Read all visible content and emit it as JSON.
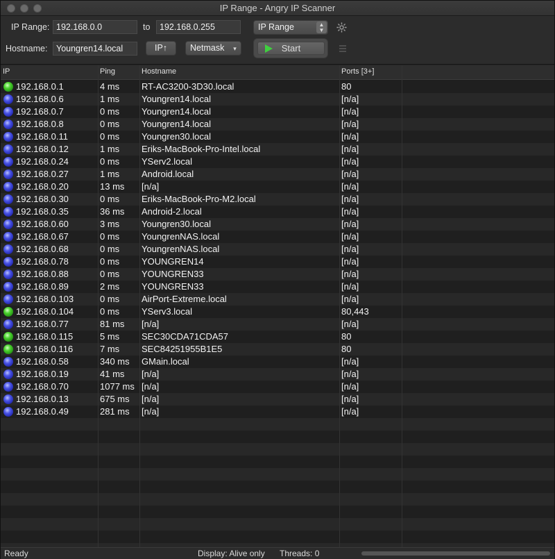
{
  "window": {
    "title": "IP Range - Angry IP Scanner"
  },
  "toolbar": {
    "ip_range_label": "IP Range:",
    "ip_start": "192.168.0.0",
    "to_label": "to",
    "ip_end": "192.168.0.255",
    "feeder_select": "IP Range",
    "hostname_label": "Hostname:",
    "hostname_value": "Youngren14.local",
    "ip_up_button": "IP↑",
    "netmask_select": "Netmask",
    "start_button": "Start"
  },
  "table": {
    "columns": [
      "IP",
      "Ping",
      "Hostname",
      "Ports [3+]"
    ],
    "rows": [
      {
        "status": "green",
        "ip": "192.168.0.1",
        "ping": "4 ms",
        "hostname": "RT-AC3200-3D30.local",
        "ports": "80"
      },
      {
        "status": "blue",
        "ip": "192.168.0.6",
        "ping": "1 ms",
        "hostname": "Youngren14.local",
        "ports": "[n/a]"
      },
      {
        "status": "blue",
        "ip": "192.168.0.7",
        "ping": "0 ms",
        "hostname": "Youngren14.local",
        "ports": "[n/a]"
      },
      {
        "status": "blue",
        "ip": "192.168.0.8",
        "ping": "0 ms",
        "hostname": "Youngren14.local",
        "ports": "[n/a]"
      },
      {
        "status": "blue",
        "ip": "192.168.0.11",
        "ping": "0 ms",
        "hostname": "Youngren30.local",
        "ports": "[n/a]"
      },
      {
        "status": "blue",
        "ip": "192.168.0.12",
        "ping": "1 ms",
        "hostname": "Eriks-MacBook-Pro-Intel.local",
        "ports": "[n/a]"
      },
      {
        "status": "blue",
        "ip": "192.168.0.24",
        "ping": "0 ms",
        "hostname": "YServ2.local",
        "ports": "[n/a]"
      },
      {
        "status": "blue",
        "ip": "192.168.0.27",
        "ping": "1 ms",
        "hostname": "Android.local",
        "ports": "[n/a]"
      },
      {
        "status": "blue",
        "ip": "192.168.0.20",
        "ping": "13 ms",
        "hostname": "[n/a]",
        "ports": "[n/a]"
      },
      {
        "status": "blue",
        "ip": "192.168.0.30",
        "ping": "0 ms",
        "hostname": "Eriks-MacBook-Pro-M2.local",
        "ports": "[n/a]"
      },
      {
        "status": "blue",
        "ip": "192.168.0.35",
        "ping": "36 ms",
        "hostname": "Android-2.local",
        "ports": "[n/a]"
      },
      {
        "status": "blue",
        "ip": "192.168.0.60",
        "ping": "3 ms",
        "hostname": "Youngren30.local",
        "ports": "[n/a]"
      },
      {
        "status": "blue",
        "ip": "192.168.0.67",
        "ping": "0 ms",
        "hostname": "YoungrenNAS.local",
        "ports": "[n/a]"
      },
      {
        "status": "blue",
        "ip": "192.168.0.68",
        "ping": "0 ms",
        "hostname": "YoungrenNAS.local",
        "ports": "[n/a]"
      },
      {
        "status": "blue",
        "ip": "192.168.0.78",
        "ping": "0 ms",
        "hostname": "YOUNGREN14",
        "ports": "[n/a]"
      },
      {
        "status": "blue",
        "ip": "192.168.0.88",
        "ping": "0 ms",
        "hostname": "YOUNGREN33",
        "ports": "[n/a]"
      },
      {
        "status": "blue",
        "ip": "192.168.0.89",
        "ping": "2 ms",
        "hostname": "YOUNGREN33",
        "ports": "[n/a]"
      },
      {
        "status": "blue",
        "ip": "192.168.0.103",
        "ping": "0 ms",
        "hostname": "AirPort-Extreme.local",
        "ports": "[n/a]"
      },
      {
        "status": "green",
        "ip": "192.168.0.104",
        "ping": "0 ms",
        "hostname": "YServ3.local",
        "ports": "80,443"
      },
      {
        "status": "blue",
        "ip": "192.168.0.77",
        "ping": "81 ms",
        "hostname": "[n/a]",
        "ports": "[n/a]"
      },
      {
        "status": "green",
        "ip": "192.168.0.115",
        "ping": "5 ms",
        "hostname": "SEC30CDA71CDA57",
        "ports": "80"
      },
      {
        "status": "green",
        "ip": "192.168.0.116",
        "ping": "7 ms",
        "hostname": "SEC84251955B1E5",
        "ports": "80"
      },
      {
        "status": "blue",
        "ip": "192.168.0.58",
        "ping": "340 ms",
        "hostname": "GMain.local",
        "ports": "[n/a]"
      },
      {
        "status": "blue",
        "ip": "192.168.0.19",
        "ping": "41 ms",
        "hostname": "[n/a]",
        "ports": "[n/a]"
      },
      {
        "status": "blue",
        "ip": "192.168.0.70",
        "ping": "1077 ms",
        "hostname": "[n/a]",
        "ports": "[n/a]"
      },
      {
        "status": "blue",
        "ip": "192.168.0.13",
        "ping": "675 ms",
        "hostname": "[n/a]",
        "ports": "[n/a]"
      },
      {
        "status": "blue",
        "ip": "192.168.0.49",
        "ping": "281 ms",
        "hostname": "[n/a]",
        "ports": "[n/a]"
      }
    ]
  },
  "statusbar": {
    "state": "Ready",
    "display": "Display: Alive only",
    "threads": "Threads: 0"
  },
  "colors": {
    "alive_open_ports": "#4ad12e",
    "alive": "#4b55e6"
  },
  "icons": {
    "settings": "gear-icon",
    "start": "play-icon",
    "fetchers": "list-icon"
  }
}
